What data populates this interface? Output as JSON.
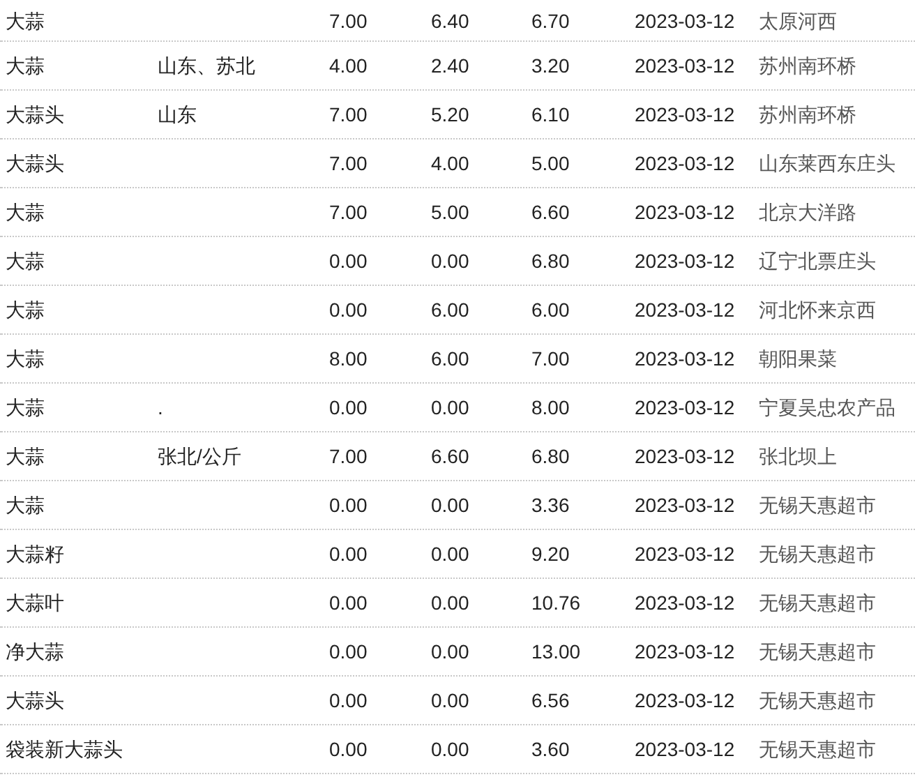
{
  "table": {
    "rows": [
      {
        "column_1": "大蒜",
        "column_3": "7.00",
        "column_4": "6.40",
        "column_5": "6.70",
        "column_6": "2023-03-12",
        "column_7": "太原河西"
      },
      {
        "column_1": "大蒜",
        "column_2": "山东、苏北",
        "column_3": "4.00",
        "column_4": "2.40",
        "column_5": "3.20",
        "column_6": "2023-03-12",
        "column_7": "苏州南环桥"
      },
      {
        "column_1": "大蒜头",
        "column_2": "山东",
        "column_3": "7.00",
        "column_4": "5.20",
        "column_5": "6.10",
        "column_6": "2023-03-12",
        "column_7": "苏州南环桥"
      },
      {
        "column_1": "大蒜头",
        "column_3": "7.00",
        "column_4": "4.00",
        "column_5": "5.00",
        "column_6": "2023-03-12",
        "column_7": "山东莱西东庄头"
      },
      {
        "column_1": "大蒜",
        "column_3": "7.00",
        "column_4": "5.00",
        "column_5": "6.60",
        "column_6": "2023-03-12",
        "column_7": "北京大洋路"
      },
      {
        "column_1": "大蒜",
        "column_3": "0.00",
        "column_4": "0.00",
        "column_5": "6.80",
        "column_6": "2023-03-12",
        "column_7": "辽宁北票庄头"
      },
      {
        "column_1": "大蒜",
        "column_3": "0.00",
        "column_4": "6.00",
        "column_5": "6.00",
        "column_6": "2023-03-12",
        "column_7": "河北怀来京西"
      },
      {
        "column_1": "大蒜",
        "column_3": "8.00",
        "column_4": "6.00",
        "column_5": "7.00",
        "column_6": "2023-03-12",
        "column_7": "朝阳果菜"
      },
      {
        "column_1": "大蒜",
        "column_2": ".",
        "column_3": "0.00",
        "column_4": "0.00",
        "column_5": "8.00",
        "column_6": "2023-03-12",
        "column_7": "宁夏吴忠农产品"
      },
      {
        "column_1": "大蒜",
        "column_2": "张北/公斤",
        "column_3": "7.00",
        "column_4": "6.60",
        "column_5": "6.80",
        "column_6": "2023-03-12",
        "column_7": "张北坝上"
      },
      {
        "column_1": "大蒜",
        "column_3": "0.00",
        "column_4": "0.00",
        "column_5": "3.36",
        "column_6": "2023-03-12",
        "column_7": "无锡天惠超市"
      },
      {
        "column_1": "大蒜籽",
        "column_3": "0.00",
        "column_4": "0.00",
        "column_5": "9.20",
        "column_6": "2023-03-12",
        "column_7": "无锡天惠超市"
      },
      {
        "column_1": "大蒜叶",
        "column_3": "0.00",
        "column_4": "0.00",
        "column_5": "10.76",
        "column_6": "2023-03-12",
        "column_7": "无锡天惠超市"
      },
      {
        "column_1": "净大蒜",
        "column_3": "0.00",
        "column_4": "0.00",
        "column_5": "13.00",
        "column_6": "2023-03-12",
        "column_7": "无锡天惠超市"
      },
      {
        "column_1": "大蒜头",
        "column_3": "0.00",
        "column_4": "0.00",
        "column_5": "6.56",
        "column_6": "2023-03-12",
        "column_7": "无锡天惠超市"
      },
      {
        "column_1": "袋装新大蒜头",
        "column_3": "0.00",
        "column_4": "0.00",
        "column_5": "3.60",
        "column_6": "2023-03-12",
        "column_7": "无锡天惠超市"
      }
    ]
  }
}
